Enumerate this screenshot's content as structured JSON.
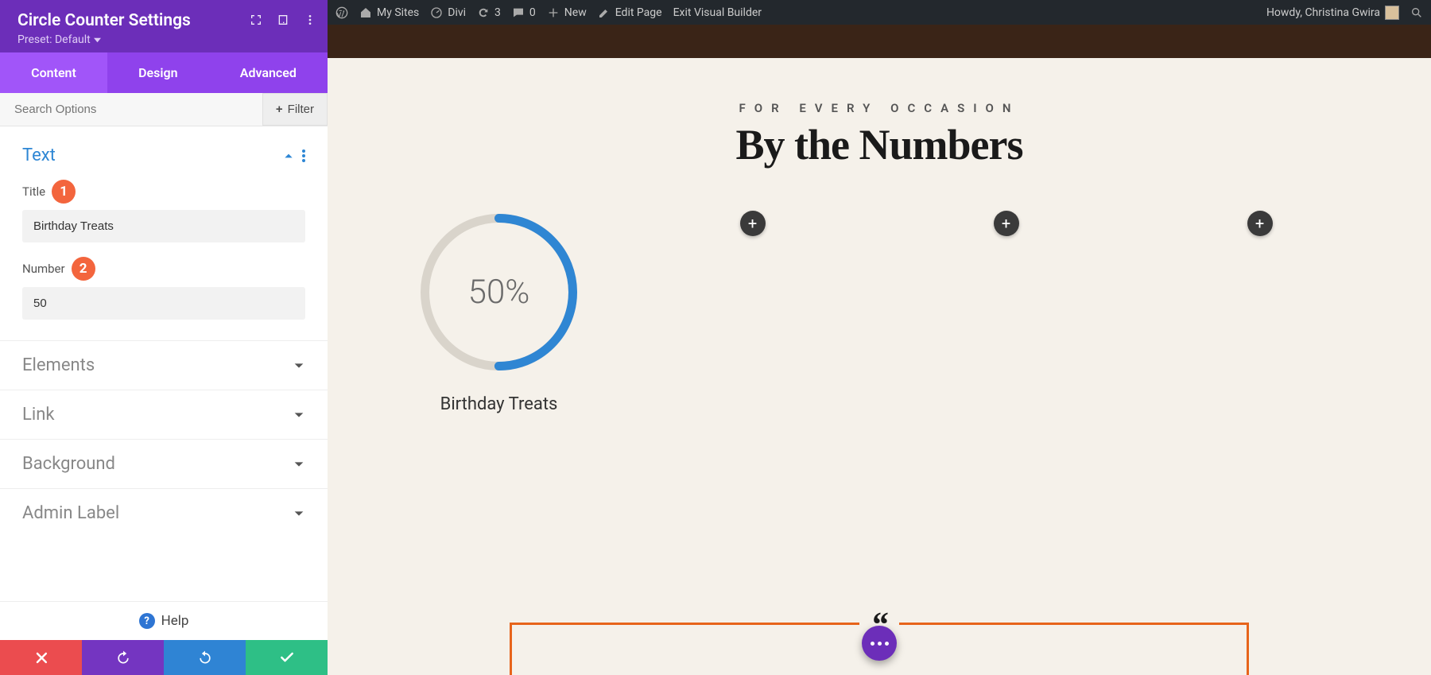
{
  "panel": {
    "title": "Circle Counter Settings",
    "preset_label": "Preset: Default",
    "tabs": {
      "content": "Content",
      "design": "Design",
      "advanced": "Advanced"
    },
    "search_placeholder": "Search Options",
    "filter_label": "Filter",
    "sections": {
      "text": "Text",
      "elements": "Elements",
      "link": "Link",
      "background": "Background",
      "admin_label": "Admin Label"
    },
    "text_fields": {
      "title_label": "Title",
      "title_value": "Birthday Treats",
      "number_label": "Number",
      "number_value": "50"
    },
    "callouts": {
      "title": "1",
      "number": "2"
    },
    "help": "Help"
  },
  "adminbar": {
    "my_sites": "My Sites",
    "site": "Divi",
    "updates": "3",
    "comments": "0",
    "new": "New",
    "edit_page": "Edit Page",
    "exit_vb": "Exit Visual Builder",
    "howdy": "Howdy, Christina Gwira"
  },
  "page": {
    "eyebrow": "FOR EVERY OCCASION",
    "headline": "By the Numbers",
    "counter": {
      "percent": 50,
      "display": "50%",
      "label": "Birthday Treats"
    }
  },
  "colors": {
    "accent": "#2f86d3",
    "panel": "#6c2eb9"
  }
}
